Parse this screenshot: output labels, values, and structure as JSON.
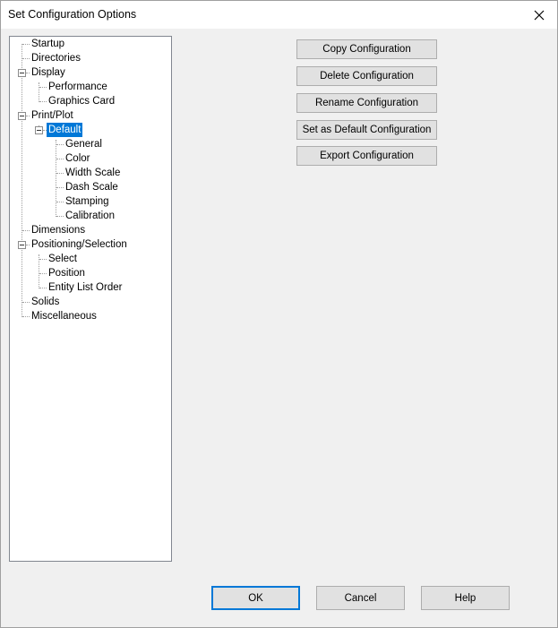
{
  "window": {
    "title": "Set Configuration Options"
  },
  "tree": {
    "items": [
      {
        "label": "Startup"
      },
      {
        "label": "Directories"
      },
      {
        "label": "Display"
      },
      {
        "label": "Performance"
      },
      {
        "label": "Graphics Card"
      },
      {
        "label": "Print/Plot"
      },
      {
        "label": "Default",
        "selected": true
      },
      {
        "label": "General"
      },
      {
        "label": "Color"
      },
      {
        "label": "Width Scale"
      },
      {
        "label": "Dash Scale"
      },
      {
        "label": "Stamping"
      },
      {
        "label": "Calibration"
      },
      {
        "label": "Dimensions"
      },
      {
        "label": "Positioning/Selection"
      },
      {
        "label": "Select"
      },
      {
        "label": "Position"
      },
      {
        "label": "Entity List Order"
      },
      {
        "label": "Solids"
      },
      {
        "label": "Miscellaneous"
      }
    ]
  },
  "actions": {
    "copy": "Copy Configuration",
    "delete": "Delete Configuration",
    "rename": "Rename Configuration",
    "set_default": "Set as Default Configuration",
    "export": "Export Configuration"
  },
  "footer": {
    "ok": "OK",
    "cancel": "Cancel",
    "help": "Help"
  },
  "colors": {
    "selection": "#0078d7",
    "default_button_border": "#0078d7"
  }
}
